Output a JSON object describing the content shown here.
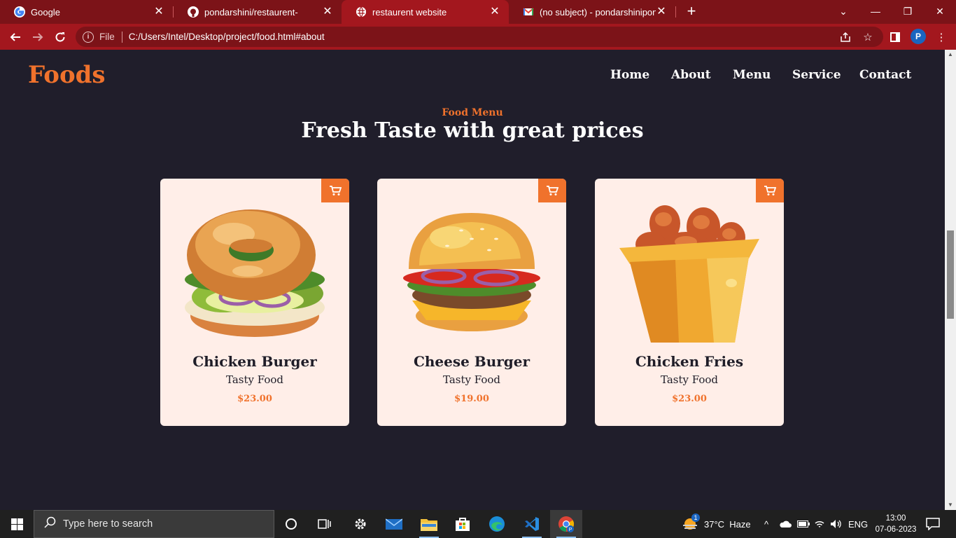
{
  "browser": {
    "tabs": [
      {
        "title": "Google",
        "icon": "google-icon",
        "active": false
      },
      {
        "title": "pondarshini/restaurent-",
        "icon": "github-icon",
        "active": false
      },
      {
        "title": "restaurent website",
        "icon": "globe-icon",
        "active": true
      },
      {
        "title": "(no subject) - pondarshiniponkur",
        "icon": "gmail-icon",
        "active": false
      }
    ],
    "new_tab_symbol": "+",
    "address": {
      "scheme_label": "File",
      "url": "C:/Users/Intel/Desktop/project/food.html#about"
    },
    "profile_initial": "P"
  },
  "page": {
    "logo": "Foods",
    "nav": [
      "Home",
      "About",
      "Menu",
      "Service",
      "Contact"
    ],
    "section_subtitle": "Food Menu",
    "section_title": "Fresh Taste with great prices",
    "cards": [
      {
        "name": "Chicken Burger",
        "desc": "Tasty Food",
        "price": "$23.00",
        "image": "chicken-burger-illustration"
      },
      {
        "name": "Cheese Burger",
        "desc": "Tasty Food",
        "price": "$19.00",
        "image": "cheese-burger-illustration"
      },
      {
        "name": "Chicken Fries",
        "desc": "Tasty Food",
        "price": "$23.00",
        "image": "chicken-fries-illustration"
      }
    ],
    "accent_color": "#f0722c",
    "background_color": "#201e2b",
    "card_color": "#ffeee8"
  },
  "taskbar": {
    "search_placeholder": "Type here to search",
    "weather": "37°C  Haze",
    "language": "ENG",
    "time": "13:00",
    "date": "07-06-2023",
    "weather_badge": "1"
  }
}
